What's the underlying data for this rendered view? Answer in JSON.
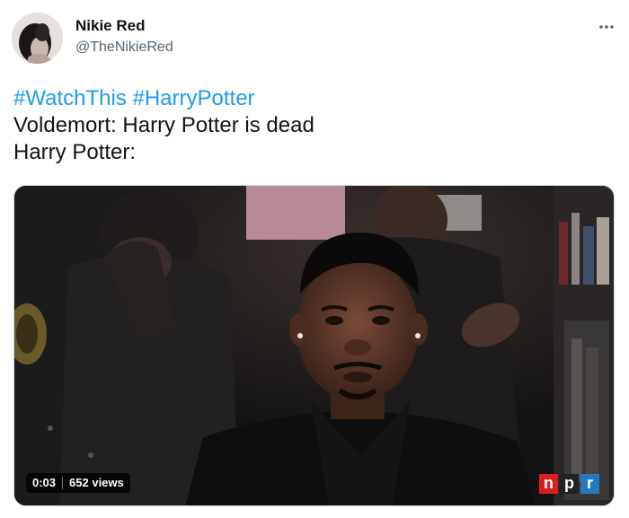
{
  "author": {
    "display_name": "Nikie Red",
    "handle": "@TheNikieRed"
  },
  "tweet": {
    "hashtags": [
      "#WatchThis",
      "#HarryPotter"
    ],
    "line2": "Voldemort: Harry Potter is dead",
    "line3": "Harry Potter:"
  },
  "video": {
    "time": "0:03",
    "views": "652 views",
    "logo_letters": [
      "n",
      "p",
      "r"
    ],
    "logo_colors": [
      "#d62021",
      "#222222",
      "#237bbd"
    ]
  },
  "icons": {
    "more": "more-horizontal-icon"
  },
  "colors": {
    "link": "#1d9bf0",
    "secondary_text": "#536471",
    "primary_text": "#0f1419"
  }
}
